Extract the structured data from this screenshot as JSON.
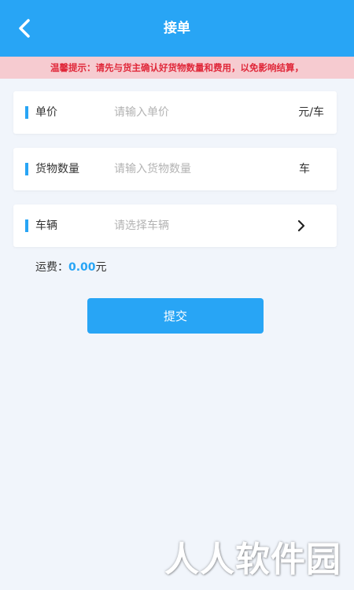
{
  "header": {
    "title": "接单",
    "back_icon": "chevron-left-icon"
  },
  "notice": {
    "text": "温馨提示：请先与货主确认好货物数量和费用，以免影响结算，"
  },
  "form": {
    "unit_price": {
      "label": "单价",
      "placeholder": "请输入单价",
      "value": "",
      "unit": "元/车"
    },
    "quantity": {
      "label": "货物数量",
      "placeholder": "请输入货物数量",
      "value": "",
      "unit": "车"
    },
    "vehicle": {
      "label": "车辆",
      "placeholder": "请选择车辆",
      "icon": "chevron-right-icon"
    }
  },
  "fee": {
    "label": "运费：",
    "value": "0.00",
    "unit": "元"
  },
  "submit": {
    "label": "提交"
  },
  "watermark": {
    "text": "人人软件园"
  },
  "colors": {
    "primary": "#28a5f5",
    "notice_bg": "#f6cbd0",
    "notice_text": "#e0283a",
    "page_bg": "#f1f5fb"
  }
}
